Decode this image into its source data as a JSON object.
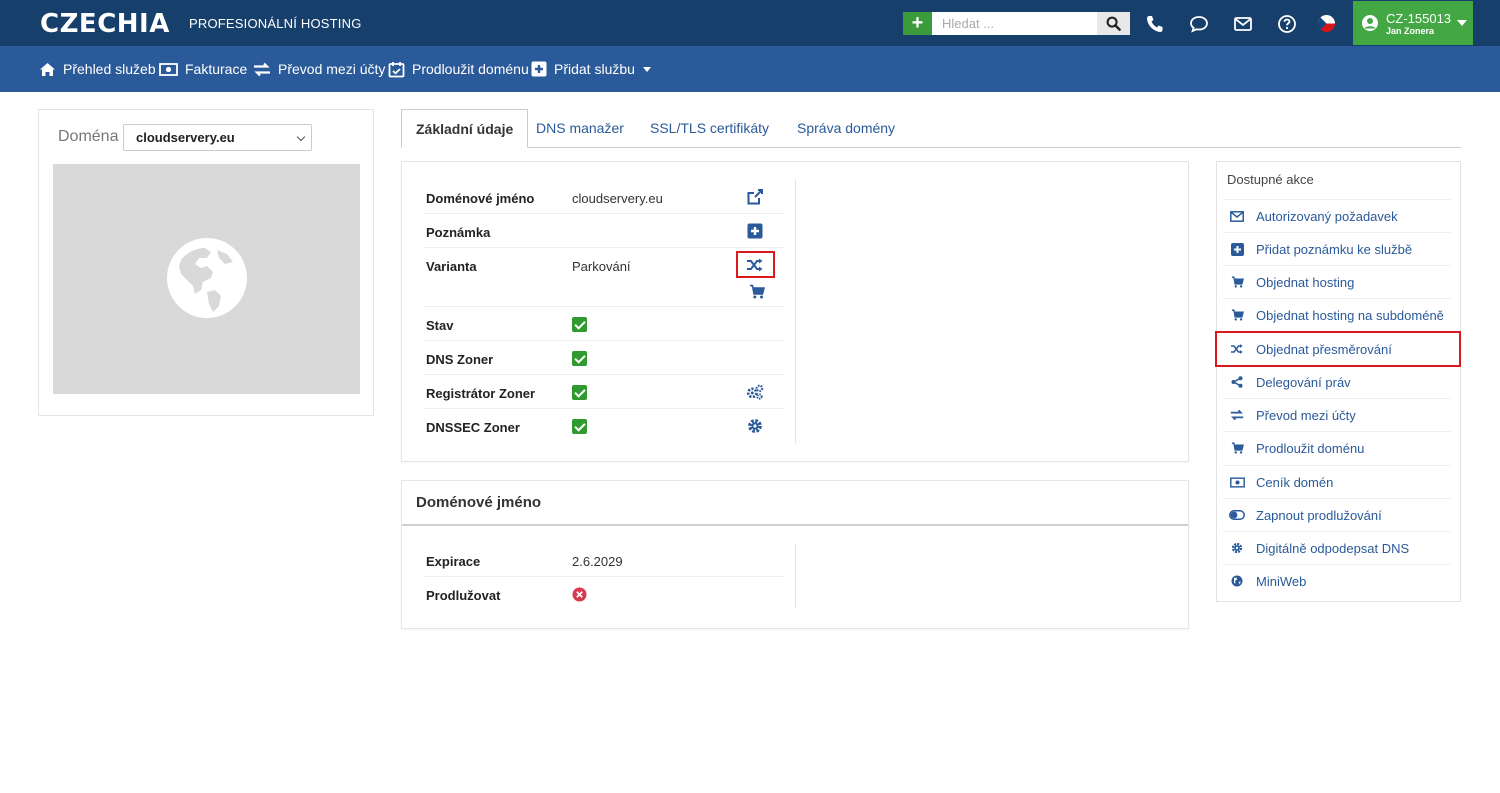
{
  "header": {
    "logo": "CZECHIA",
    "tagline": "PROFESIONÁLNÍ HOSTING",
    "search_placeholder": "Hledat ...",
    "user_id": "CZ-155013",
    "user_name": "Jan Zonera",
    "brand_color": "#173f6b",
    "accent_green": "#43a843"
  },
  "nav": {
    "items": [
      {
        "label": "Přehled služeb",
        "icon": "home-icon"
      },
      {
        "label": "Fakturace",
        "icon": "money-icon"
      },
      {
        "label": "Převod mezi účty",
        "icon": "exchange-icon"
      },
      {
        "label": "Prodloužit doménu",
        "icon": "calendar-check-icon"
      },
      {
        "label": "Přidat službu",
        "icon": "plus-square-icon"
      }
    ]
  },
  "left": {
    "domain_label": "Doména",
    "selected_domain": "cloudservery.eu"
  },
  "tabs": [
    "Základní údaje",
    "DNS manažer",
    "SSL/TLS certifikáty",
    "Správa domény"
  ],
  "basic": {
    "rows": [
      {
        "label": "Doménové jméno",
        "value": "cloudservery.eu"
      },
      {
        "label": "Poznámka",
        "value": ""
      },
      {
        "label": "Varianta",
        "value": "Parkování"
      },
      {
        "label": "Stav",
        "value": ""
      },
      {
        "label": "DNS Zoner",
        "value": ""
      },
      {
        "label": "Registrátor Zoner",
        "value": ""
      },
      {
        "label": "DNSSEC Zoner",
        "value": ""
      }
    ]
  },
  "domain_section": {
    "title": "Doménové jméno",
    "rows": [
      {
        "label": "Expirace",
        "value": "2.6.2029"
      },
      {
        "label": "Prodlužovat",
        "value": ""
      }
    ]
  },
  "actions": {
    "title": "Dostupné akce",
    "items": [
      {
        "label": "Autorizovaný požadavek",
        "icon": "envelope-icon"
      },
      {
        "label": "Přidat poznámku ke službě",
        "icon": "plus-square-icon"
      },
      {
        "label": "Objednat hosting",
        "icon": "cart-icon"
      },
      {
        "label": "Objednat hosting na subdoméně",
        "icon": "cart-icon"
      },
      {
        "label": "Objednat přesměrování",
        "icon": "shuffle-icon"
      },
      {
        "label": "Delegování práv",
        "icon": "share-icon"
      },
      {
        "label": "Převod mezi účty",
        "icon": "exchange-icon"
      },
      {
        "label": "Prodloužit doménu",
        "icon": "cart-icon"
      },
      {
        "label": "Ceník domén",
        "icon": "money-icon"
      },
      {
        "label": "Zapnout prodlužování",
        "icon": "toggle-icon"
      },
      {
        "label": "Digitálně odpodepsat DNS",
        "icon": "gear-icon"
      },
      {
        "label": "MiniWeb",
        "icon": "globe-icon"
      }
    ]
  }
}
